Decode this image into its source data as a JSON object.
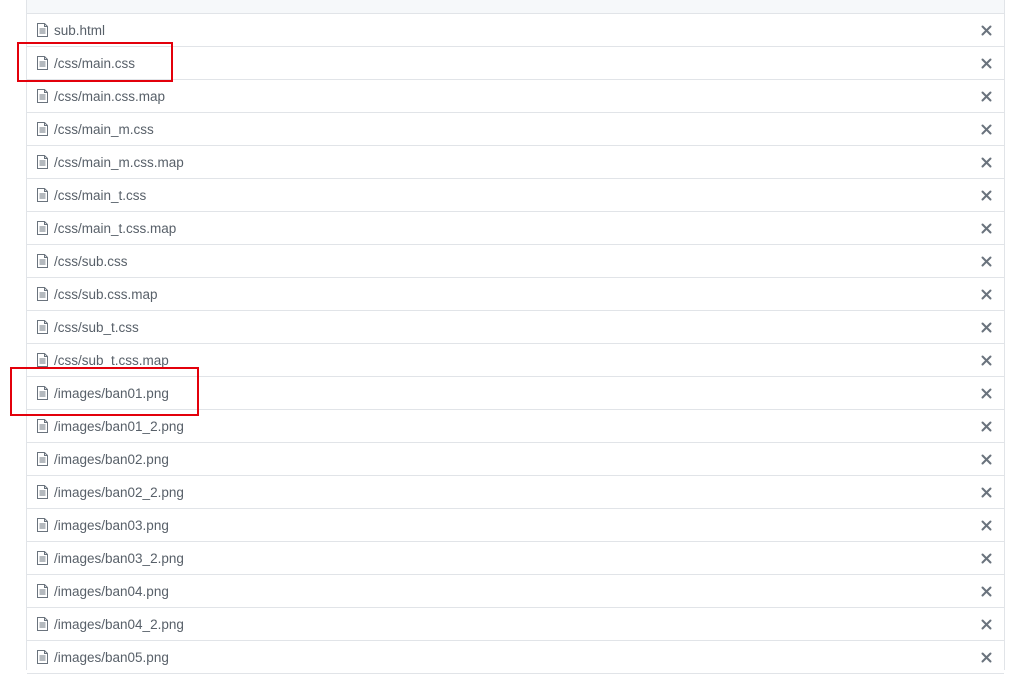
{
  "files": [
    {
      "name": "sub.html"
    },
    {
      "name": "/css/main.css"
    },
    {
      "name": "/css/main.css.map"
    },
    {
      "name": "/css/main_m.css"
    },
    {
      "name": "/css/main_m.css.map"
    },
    {
      "name": "/css/main_t.css"
    },
    {
      "name": "/css/main_t.css.map"
    },
    {
      "name": "/css/sub.css"
    },
    {
      "name": "/css/sub.css.map"
    },
    {
      "name": "/css/sub_t.css"
    },
    {
      "name": "/css/sub_t.css.map"
    },
    {
      "name": "/images/ban01.png"
    },
    {
      "name": "/images/ban01_2.png"
    },
    {
      "name": "/images/ban02.png"
    },
    {
      "name": "/images/ban02_2.png"
    },
    {
      "name": "/images/ban03.png"
    },
    {
      "name": "/images/ban03_2.png"
    },
    {
      "name": "/images/ban04.png"
    },
    {
      "name": "/images/ban04_2.png"
    },
    {
      "name": "/images/ban05.png"
    }
  ],
  "icons": {
    "file": "file-text-icon",
    "remove": "close-icon"
  },
  "colors": {
    "text": "#586069",
    "border": "#e1e4e8",
    "remove_icon": "#6a737d",
    "highlight": "#e3000b"
  }
}
